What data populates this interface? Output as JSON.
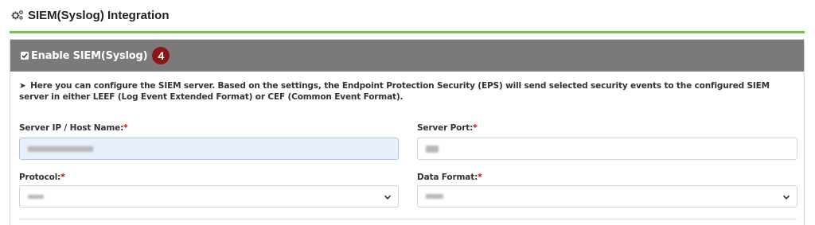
{
  "page": {
    "title": "SIEM(Syslog) Integration",
    "title_icon": "gears-icon"
  },
  "panel": {
    "enable_label": "Enable SIEM(Syslog)",
    "enable_checked": true,
    "step_badge": "4",
    "info_arrow": "➤",
    "info_text": "Here you can configure the SIEM server. Based on the settings, the Endpoint Protection Security (EPS) will send selected security events to the configured SIEM server in either LEEF (Log Event Extended Format) or CEF (Common Event Format)."
  },
  "form": {
    "server_ip": {
      "label": "Server IP / Host Name:",
      "required_mark": "*"
    },
    "server_port": {
      "label": "Server Port:",
      "required_mark": "*"
    },
    "protocol": {
      "label": "Protocol:",
      "required_mark": "*"
    },
    "data_format": {
      "label": "Data Format:",
      "required_mark": "*"
    }
  },
  "colors": {
    "accent_rule": "#6cc644",
    "panel_header": "#7a7a7a",
    "badge": "#8b1414",
    "required": "#d40000",
    "focused_input": "#e8f0fe"
  }
}
